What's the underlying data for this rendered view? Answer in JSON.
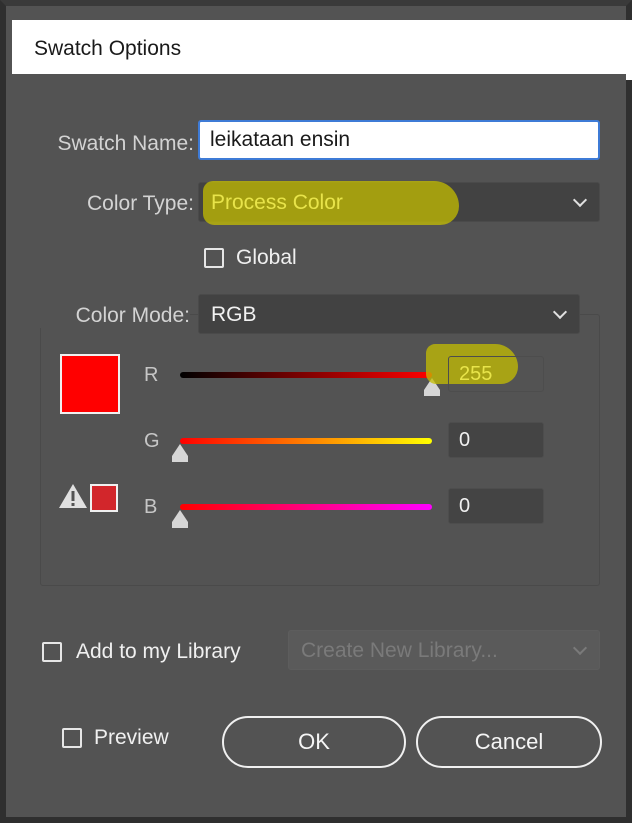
{
  "dialog": {
    "title": "Swatch Options"
  },
  "swatch_name": {
    "label": "Swatch Name:",
    "value": "leikataan ensin"
  },
  "color_type": {
    "label": "Color Type:",
    "value": "Process Color"
  },
  "global": {
    "label": "Global",
    "checked": false
  },
  "color_mode": {
    "label": "Color Mode:",
    "value": "RGB"
  },
  "sliders": [
    {
      "label": "R",
      "value": "255",
      "fraction": 1.0,
      "gradient": [
        "#000000",
        "#ff0000"
      ]
    },
    {
      "label": "G",
      "value": "0",
      "fraction": 0.0,
      "gradient": [
        "#ff0000",
        "#ffff00"
      ]
    },
    {
      "label": "B",
      "value": "0",
      "fraction": 0.0,
      "gradient": [
        "#ff0000",
        "#ff00ff"
      ]
    }
  ],
  "swatch_color": "#ff0000",
  "gamut_color": "#d2262b",
  "library": {
    "label": "Add to my Library",
    "checked": false,
    "dropdown": "Create New Library..."
  },
  "preview": {
    "label": "Preview",
    "checked": false
  },
  "buttons": {
    "ok": "OK",
    "cancel": "Cancel"
  }
}
